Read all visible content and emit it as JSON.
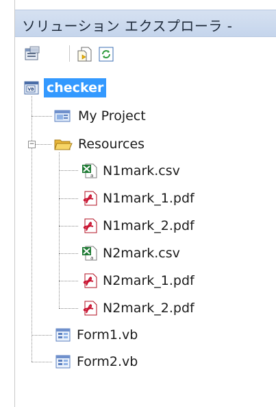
{
  "window": {
    "title": "ソリューション エクスプローラ -"
  },
  "toolbar": {
    "buttons": [
      {
        "icon": "properties-icon"
      },
      {
        "icon": "show-all-files-icon"
      },
      {
        "icon": "refresh-icon"
      }
    ]
  },
  "tree": {
    "root": {
      "label": "checker",
      "icon": "vb-project-icon",
      "selected": true
    },
    "my_project": {
      "label": "My Project",
      "icon": "my-project-icon"
    },
    "resources": {
      "label": "Resources",
      "icon": "folder-open-icon",
      "expanded": true,
      "expander_symbol": "−",
      "files": [
        {
          "label": "N1mark.csv",
          "icon": "csv-file-icon"
        },
        {
          "label": "N1mark_1.pdf",
          "icon": "pdf-file-icon"
        },
        {
          "label": "N1mark_2.pdf",
          "icon": "pdf-file-icon"
        },
        {
          "label": "N2mark.csv",
          "icon": "csv-file-icon"
        },
        {
          "label": "N2mark_1.pdf",
          "icon": "pdf-file-icon"
        },
        {
          "label": "N2mark_2.pdf",
          "icon": "pdf-file-icon"
        }
      ]
    },
    "forms": [
      {
        "label": "Form1.vb",
        "icon": "form-file-icon"
      },
      {
        "label": "Form2.vb",
        "icon": "form-file-icon"
      }
    ]
  },
  "colors": {
    "selection": "#3399ff",
    "titlebar": "#c5d5ec",
    "pdf_red": "#c8102e",
    "csv_green": "#1e7b34",
    "folder_yellow": "#f3c64a"
  }
}
